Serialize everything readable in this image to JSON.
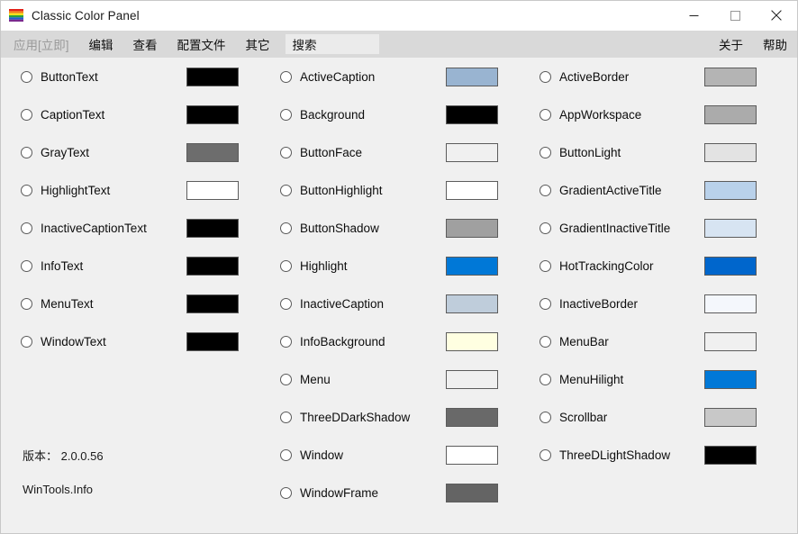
{
  "window": {
    "title": "Classic Color Panel",
    "icon": "rainbow-palette-icon",
    "caption_buttons": [
      {
        "name": "minimize",
        "glyph": "minimize-icon"
      },
      {
        "name": "maximize",
        "glyph": "maximize-icon"
      },
      {
        "name": "close",
        "glyph": "close-icon"
      }
    ]
  },
  "menubar": {
    "items": [
      {
        "label": "应用[立即]",
        "name": "apply-now",
        "disabled": true
      },
      {
        "label": "编辑",
        "name": "edit",
        "disabled": false
      },
      {
        "label": "查看",
        "name": "view",
        "disabled": false
      },
      {
        "label": "配置文件",
        "name": "profile",
        "disabled": false
      },
      {
        "label": "其它",
        "name": "other",
        "disabled": false
      }
    ],
    "search": {
      "value": "搜索",
      "placeholder": "搜索"
    },
    "right_items": [
      {
        "label": "关于",
        "name": "about"
      },
      {
        "label": "帮助",
        "name": "help"
      }
    ]
  },
  "footer": {
    "version": "版本： 2.0.0.56",
    "site": "WinTools.Info"
  },
  "columns": [
    {
      "name": "column-1",
      "rows": [
        {
          "label": "ButtonText",
          "color": "#000000"
        },
        {
          "label": "CaptionText",
          "color": "#000000"
        },
        {
          "label": "GrayText",
          "color": "#6D6D6D"
        },
        {
          "label": "HighlightText",
          "color": "#FFFFFF"
        },
        {
          "label": "InactiveCaptionText",
          "color": "#000000"
        },
        {
          "label": "InfoText",
          "color": "#000000"
        },
        {
          "label": "MenuText",
          "color": "#000000"
        },
        {
          "label": "WindowText",
          "color": "#000000"
        }
      ]
    },
    {
      "name": "column-2",
      "rows": [
        {
          "label": "ActiveCaption",
          "color": "#99B4D1"
        },
        {
          "label": "Background",
          "color": "#000000"
        },
        {
          "label": "ButtonFace",
          "color": "#F0F0F0"
        },
        {
          "label": "ButtonHighlight",
          "color": "#FFFFFF"
        },
        {
          "label": "ButtonShadow",
          "color": "#A0A0A0"
        },
        {
          "label": "Highlight",
          "color": "#0078D7"
        },
        {
          "label": "InactiveCaption",
          "color": "#BFCDDB"
        },
        {
          "label": "InfoBackground",
          "color": "#FFFFE1"
        },
        {
          "label": "Menu",
          "color": "#F0F0F0"
        },
        {
          "label": "ThreeDDarkShadow",
          "color": "#696969"
        },
        {
          "label": "Window",
          "color": "#FFFFFF"
        },
        {
          "label": "WindowFrame",
          "color": "#646464"
        }
      ]
    },
    {
      "name": "column-3",
      "rows": [
        {
          "label": "ActiveBorder",
          "color": "#B4B4B4"
        },
        {
          "label": "AppWorkspace",
          "color": "#ABABAB"
        },
        {
          "label": "ButtonLight",
          "color": "#E3E3E3"
        },
        {
          "label": "GradientActiveTitle",
          "color": "#B9D1EA"
        },
        {
          "label": "GradientInactiveTitle",
          "color": "#D7E4F2"
        },
        {
          "label": "HotTrackingColor",
          "color": "#0066CC"
        },
        {
          "label": "InactiveBorder",
          "color": "#F4F7FC"
        },
        {
          "label": "MenuBar",
          "color": "#F0F0F0"
        },
        {
          "label": "MenuHilight",
          "color": "#0078D7"
        },
        {
          "label": "Scrollbar",
          "color": "#C8C8C8"
        },
        {
          "label": "ThreeDLightShadow",
          "color": "#000000"
        }
      ]
    }
  ]
}
